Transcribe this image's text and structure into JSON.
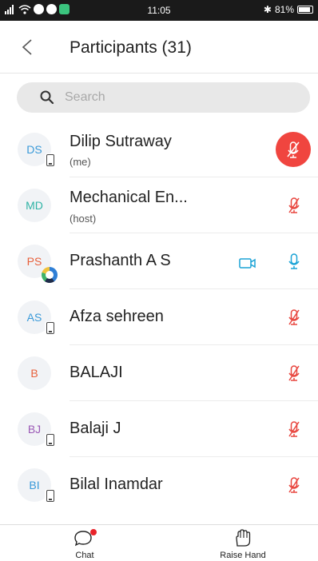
{
  "status_bar": {
    "time": "11:05",
    "bluetooth": "✱",
    "battery": "81%"
  },
  "header": {
    "title": "Participants (31)",
    "back_icon": "chevron-left-icon"
  },
  "search": {
    "placeholder": "Search",
    "icon": "search-icon"
  },
  "participants": [
    {
      "initials": "DS",
      "initials_color": "#3a9ad9",
      "name": "Dilip Sutraway",
      "role": "(me)",
      "mic": "muted-active",
      "device": "phone"
    },
    {
      "initials": "MD",
      "initials_color": "#2fb3a5",
      "name": "Mechanical En...",
      "role": "(host)",
      "mic": "muted"
    },
    {
      "initials": "PS",
      "initials_color": "#e8613c",
      "name": "Prashanth A S",
      "mic": "on",
      "video": true,
      "device": "ring"
    },
    {
      "initials": "AS",
      "initials_color": "#3a9ad9",
      "name": "Afza sehreen",
      "mic": "muted",
      "device": "phone"
    },
    {
      "initials": "B",
      "initials_color": "#e8613c",
      "name": "BALAJI",
      "mic": "muted"
    },
    {
      "initials": "BJ",
      "initials_color": "#9b59b6",
      "name": "Balaji J",
      "mic": "muted",
      "device": "phone"
    },
    {
      "initials": "BI",
      "initials_color": "#3a9ad9",
      "name": "Bilal Inamdar",
      "mic": "muted",
      "device": "phone"
    }
  ],
  "bottom_bar": {
    "chat_label": "Chat",
    "raise_hand_label": "Raise Hand"
  },
  "colors": {
    "accent_blue": "#1ba3d6",
    "muted_red": "#e8463f",
    "notification_red": "#e8232a"
  }
}
